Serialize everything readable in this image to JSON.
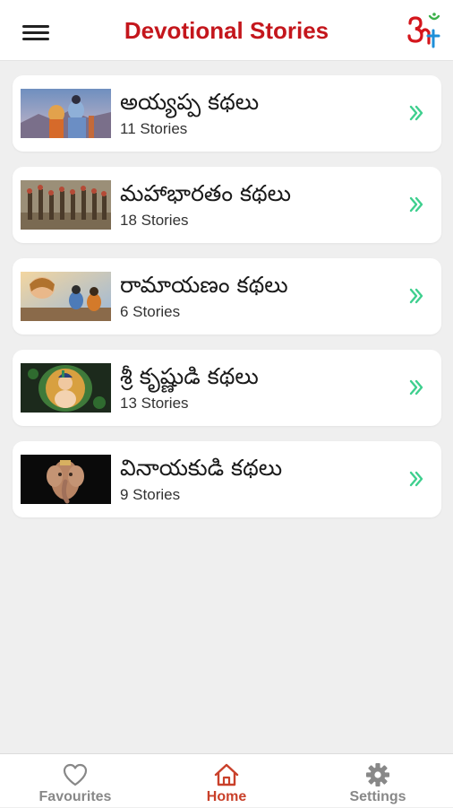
{
  "header": {
    "title": "Devotional Stories",
    "logo_icon": "om-icon",
    "menu_icon": "hamburger-menu-icon"
  },
  "categories": [
    {
      "title": "అయ్యప్ప కథలు",
      "count": "11 Stories",
      "thumb_icon": "ayyappa-image"
    },
    {
      "title": "మహాభారతం కథలు",
      "count": "18 Stories",
      "thumb_icon": "mahabharatam-image"
    },
    {
      "title": "రామాయణం కథలు",
      "count": "6 Stories",
      "thumb_icon": "ramayanam-image"
    },
    {
      "title": "శ్రీ కృష్ణుడి కథలు",
      "count": "13 Stories",
      "thumb_icon": "krishna-image"
    },
    {
      "title": "వినాయకుడి కథలు",
      "count": "9 Stories",
      "thumb_icon": "vinayaka-image"
    }
  ],
  "tabbar": {
    "favourites": "Favourites",
    "home": "Home",
    "settings": "Settings",
    "active": "home"
  },
  "colors": {
    "brand_red": "#c4161c",
    "chevron_green": "#3ecf8e",
    "tab_inactive": "#888888",
    "tab_active": "#c9402a",
    "background": "#efefef"
  }
}
